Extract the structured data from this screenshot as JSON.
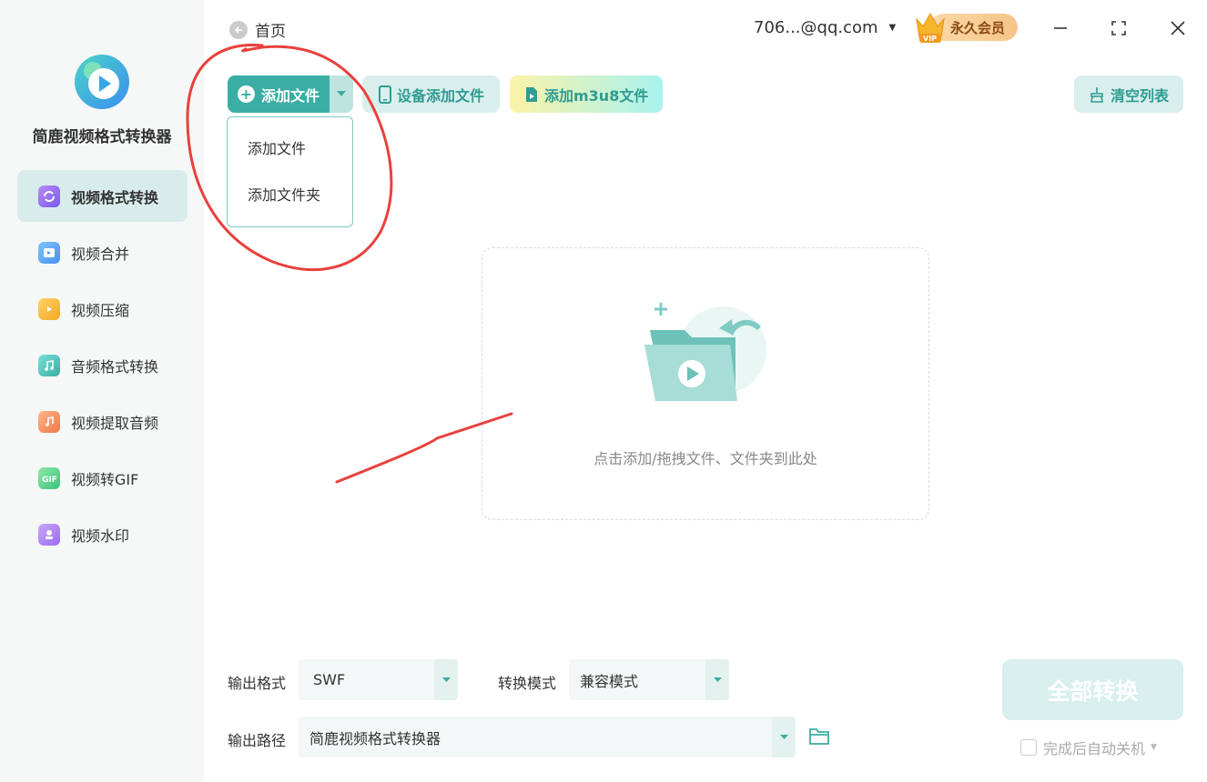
{
  "app": {
    "name": "简鹿视频格式转换器"
  },
  "sidebar": {
    "items": [
      {
        "label": "视频格式转换",
        "icon": "video-convert-icon",
        "active": true
      },
      {
        "label": "视频合并",
        "icon": "video-merge-icon",
        "active": false
      },
      {
        "label": "视频压缩",
        "icon": "video-compress-icon",
        "active": false
      },
      {
        "label": "音频格式转换",
        "icon": "audio-convert-icon",
        "active": false
      },
      {
        "label": "视频提取音频",
        "icon": "extract-audio-icon",
        "active": false
      },
      {
        "label": "视频转GIF",
        "icon": "gif-icon",
        "active": false
      },
      {
        "label": "视频水印",
        "icon": "watermark-icon",
        "active": false
      }
    ]
  },
  "header": {
    "back_label": "首页",
    "user": "706...@qq.com",
    "vip_label": "永久会员"
  },
  "toolbar": {
    "add_file": "添加文件",
    "device_add": "设备添加文件",
    "add_m3u8": "添加m3u8文件",
    "clear_list": "清空列表"
  },
  "dropdown": {
    "items": [
      "添加文件",
      "添加文件夹"
    ]
  },
  "dropzone": {
    "hint": "点击添加/拖拽文件、文件夹到此处"
  },
  "bottom": {
    "output_format_label": "输出格式",
    "output_format_value": "SWF",
    "mode_label": "转换模式",
    "mode_value": "兼容模式",
    "output_path_label": "输出路径",
    "output_path_value": "简鹿视频格式转换器",
    "convert_all": "全部转换",
    "shutdown_label": "完成后自动关机"
  },
  "colors": {
    "accent": "#3aaea4",
    "accent_light": "#d9efed",
    "annotation": "#e8413c"
  }
}
